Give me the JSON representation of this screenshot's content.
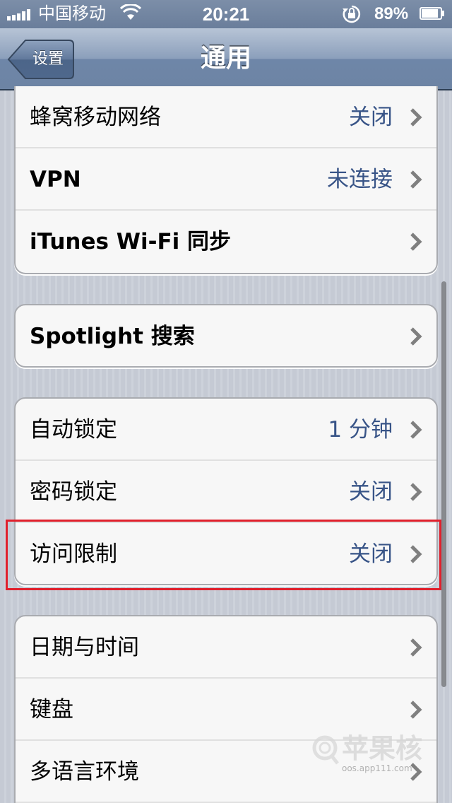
{
  "status_bar": {
    "carrier": "中国移动",
    "time": "20:21",
    "battery_percent": "89%",
    "signal_bars": 5,
    "battery_level": 0.89
  },
  "nav": {
    "back_label": "设置",
    "title": "通用"
  },
  "groups": [
    {
      "rows": [
        {
          "label": "蜂窝移动网络",
          "value": "关闭"
        },
        {
          "label": "VPN",
          "value": "未连接"
        },
        {
          "label": "iTunes Wi-Fi 同步",
          "value": ""
        }
      ]
    },
    {
      "rows": [
        {
          "label": "Spotlight 搜索",
          "value": ""
        }
      ]
    },
    {
      "rows": [
        {
          "label": "自动锁定",
          "value": "1 分钟"
        },
        {
          "label": "密码锁定",
          "value": "关闭"
        },
        {
          "label": "访问限制",
          "value": "关闭"
        }
      ]
    },
    {
      "rows": [
        {
          "label": "日期与时间",
          "value": ""
        },
        {
          "label": "键盘",
          "value": ""
        },
        {
          "label": "多语言环境",
          "value": ""
        }
      ]
    }
  ],
  "watermark": {
    "text": "苹果核",
    "url": "oos.app111.com"
  },
  "colors": {
    "value_blue": "#385487",
    "highlight_red": "#e0202c",
    "nav_blue": "#6d84a4"
  },
  "icons": [
    "signal-bars-icon",
    "wifi-icon",
    "rotation-lock-icon",
    "battery-icon",
    "chevron-right-icon"
  ]
}
